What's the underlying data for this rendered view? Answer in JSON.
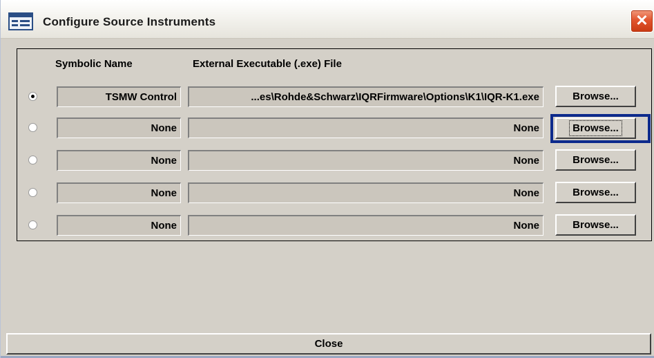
{
  "window": {
    "title": "Configure Source Instruments",
    "close_glyph": "✕",
    "icon": "app-window-icon"
  },
  "headers": {
    "symbolic_name": "Symbolic Name",
    "external_exe": "External Executable (.exe) File"
  },
  "rows": [
    {
      "selected": true,
      "name": "TSMW Control",
      "exe": "...es\\Rohde&Schwarz\\IQRFirmware\\Options\\K1\\IQR-K1.exe",
      "browse": "Browse..."
    },
    {
      "selected": false,
      "name": "None",
      "exe": "None",
      "browse": "Browse...",
      "focused": true
    },
    {
      "selected": false,
      "name": "None",
      "exe": "None",
      "browse": "Browse..."
    },
    {
      "selected": false,
      "name": "None",
      "exe": "None",
      "browse": "Browse..."
    },
    {
      "selected": false,
      "name": "None",
      "exe": "None",
      "browse": "Browse..."
    }
  ],
  "footer": {
    "close_label": "Close"
  },
  "colors": {
    "dialog_bg": "#d4d0c8",
    "field_bg": "#cbc6bd",
    "focus_ring": "#0d2a8c",
    "close_button": "#e2552e"
  }
}
